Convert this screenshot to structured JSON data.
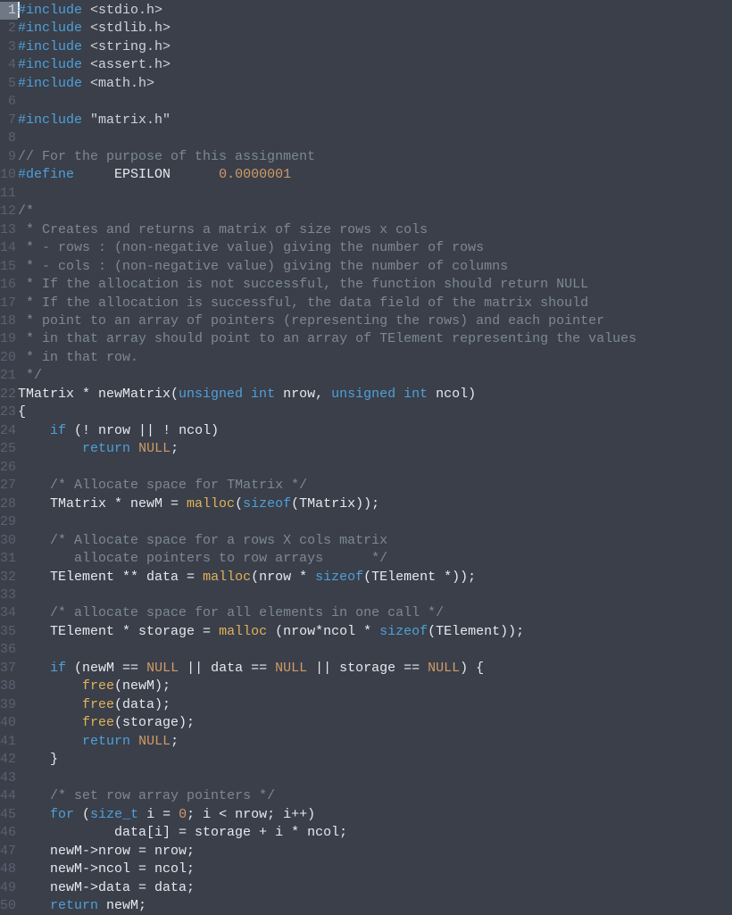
{
  "editor": {
    "active_line": 1,
    "total_lines": 50
  },
  "code": {
    "lines": [
      {
        "n": 1,
        "tokens": [
          [
            "kw",
            "#include "
          ],
          [
            "incbr",
            "<stdio.h>"
          ]
        ]
      },
      {
        "n": 2,
        "tokens": [
          [
            "kw",
            "#include "
          ],
          [
            "incbr",
            "<stdlib.h>"
          ]
        ]
      },
      {
        "n": 3,
        "tokens": [
          [
            "kw",
            "#include "
          ],
          [
            "incbr",
            "<string.h>"
          ]
        ]
      },
      {
        "n": 4,
        "tokens": [
          [
            "kw",
            "#include "
          ],
          [
            "incbr",
            "<assert.h>"
          ]
        ]
      },
      {
        "n": 5,
        "tokens": [
          [
            "kw",
            "#include "
          ],
          [
            "incbr",
            "<math.h>"
          ]
        ]
      },
      {
        "n": 6,
        "tokens": []
      },
      {
        "n": 7,
        "tokens": [
          [
            "kw",
            "#include "
          ],
          [
            "str",
            "\"matrix.h\""
          ]
        ]
      },
      {
        "n": 8,
        "tokens": []
      },
      {
        "n": 9,
        "tokens": [
          [
            "cmt",
            "// For the purpose of this assignment"
          ]
        ]
      },
      {
        "n": 10,
        "tokens": [
          [
            "kw",
            "#define"
          ],
          [
            "plain",
            "     EPSILON      "
          ],
          [
            "num",
            "0.0000001"
          ]
        ]
      },
      {
        "n": 11,
        "tokens": []
      },
      {
        "n": 12,
        "tokens": [
          [
            "cmt",
            "/*"
          ]
        ]
      },
      {
        "n": 13,
        "tokens": [
          [
            "cmt",
            " * Creates and returns a matrix of size rows x cols"
          ]
        ]
      },
      {
        "n": 14,
        "tokens": [
          [
            "cmt",
            " * - rows : (non-negative value) giving the number of rows"
          ]
        ]
      },
      {
        "n": 15,
        "tokens": [
          [
            "cmt",
            " * - cols : (non-negative value) giving the number of columns"
          ]
        ]
      },
      {
        "n": 16,
        "tokens": [
          [
            "cmt",
            " * If the allocation is not successful, the function should return NULL"
          ]
        ]
      },
      {
        "n": 17,
        "tokens": [
          [
            "cmt",
            " * If the allocation is successful, the data field of the matrix should"
          ]
        ]
      },
      {
        "n": 18,
        "tokens": [
          [
            "cmt",
            " * point to an array of pointers (representing the rows) and each pointer"
          ]
        ]
      },
      {
        "n": 19,
        "tokens": [
          [
            "cmt",
            " * in that array should point to an array of TElement representing the values"
          ]
        ]
      },
      {
        "n": 20,
        "tokens": [
          [
            "cmt",
            " * in that row."
          ]
        ]
      },
      {
        "n": 21,
        "tokens": [
          [
            "cmt",
            " */"
          ]
        ]
      },
      {
        "n": 22,
        "tokens": [
          [
            "plain",
            "TMatrix * newMatrix("
          ],
          [
            "type",
            "unsigned int"
          ],
          [
            "plain",
            " nrow, "
          ],
          [
            "type",
            "unsigned int"
          ],
          [
            "plain",
            " ncol)"
          ]
        ]
      },
      {
        "n": 23,
        "tokens": [
          [
            "plain",
            "{"
          ]
        ]
      },
      {
        "n": 24,
        "tokens": [
          [
            "plain",
            "    "
          ],
          [
            "kw",
            "if"
          ],
          [
            "plain",
            " (! nrow || ! ncol)"
          ]
        ]
      },
      {
        "n": 25,
        "tokens": [
          [
            "plain",
            "        "
          ],
          [
            "kw",
            "return"
          ],
          [
            "plain",
            " "
          ],
          [
            "null",
            "NULL"
          ],
          [
            "plain",
            ";"
          ]
        ]
      },
      {
        "n": 26,
        "tokens": []
      },
      {
        "n": 27,
        "tokens": [
          [
            "plain",
            "    "
          ],
          [
            "cmt",
            "/* Allocate space for TMatrix */"
          ]
        ]
      },
      {
        "n": 28,
        "tokens": [
          [
            "plain",
            "    TMatrix * newM = "
          ],
          [
            "fn",
            "malloc"
          ],
          [
            "plain",
            "("
          ],
          [
            "kw",
            "sizeof"
          ],
          [
            "plain",
            "(TMatrix));"
          ]
        ]
      },
      {
        "n": 29,
        "tokens": []
      },
      {
        "n": 30,
        "tokens": [
          [
            "plain",
            "    "
          ],
          [
            "cmt",
            "/* Allocate space for a rows X cols matrix"
          ]
        ]
      },
      {
        "n": 31,
        "tokens": [
          [
            "plain",
            "    "
          ],
          [
            "cmt",
            "   allocate pointers to row arrays      */"
          ]
        ]
      },
      {
        "n": 32,
        "tokens": [
          [
            "plain",
            "    TElement ** data = "
          ],
          [
            "fn",
            "malloc"
          ],
          [
            "plain",
            "(nrow * "
          ],
          [
            "kw",
            "sizeof"
          ],
          [
            "plain",
            "(TElement *));"
          ]
        ]
      },
      {
        "n": 33,
        "tokens": []
      },
      {
        "n": 34,
        "tokens": [
          [
            "plain",
            "    "
          ],
          [
            "cmt",
            "/* allocate space for all elements in one call */"
          ]
        ]
      },
      {
        "n": 35,
        "tokens": [
          [
            "plain",
            "    TElement * storage = "
          ],
          [
            "fn",
            "malloc"
          ],
          [
            "plain",
            " (nrow*ncol * "
          ],
          [
            "kw",
            "sizeof"
          ],
          [
            "plain",
            "(TElement));"
          ]
        ]
      },
      {
        "n": 36,
        "tokens": []
      },
      {
        "n": 37,
        "tokens": [
          [
            "plain",
            "    "
          ],
          [
            "kw",
            "if"
          ],
          [
            "plain",
            " (newM == "
          ],
          [
            "null",
            "NULL"
          ],
          [
            "plain",
            " || data == "
          ],
          [
            "null",
            "NULL"
          ],
          [
            "plain",
            " || storage == "
          ],
          [
            "null",
            "NULL"
          ],
          [
            "plain",
            ") {"
          ]
        ]
      },
      {
        "n": 38,
        "tokens": [
          [
            "plain",
            "        "
          ],
          [
            "fn",
            "free"
          ],
          [
            "plain",
            "(newM);"
          ]
        ]
      },
      {
        "n": 39,
        "tokens": [
          [
            "plain",
            "        "
          ],
          [
            "fn",
            "free"
          ],
          [
            "plain",
            "(data);"
          ]
        ]
      },
      {
        "n": 40,
        "tokens": [
          [
            "plain",
            "        "
          ],
          [
            "fn",
            "free"
          ],
          [
            "plain",
            "(storage);"
          ]
        ]
      },
      {
        "n": 41,
        "tokens": [
          [
            "plain",
            "        "
          ],
          [
            "kw",
            "return"
          ],
          [
            "plain",
            " "
          ],
          [
            "null",
            "NULL"
          ],
          [
            "plain",
            ";"
          ]
        ]
      },
      {
        "n": 42,
        "tokens": [
          [
            "plain",
            "    }"
          ]
        ]
      },
      {
        "n": 43,
        "tokens": []
      },
      {
        "n": 44,
        "tokens": [
          [
            "plain",
            "    "
          ],
          [
            "cmt",
            "/* set row array pointers */"
          ]
        ]
      },
      {
        "n": 45,
        "tokens": [
          [
            "plain",
            "    "
          ],
          [
            "kw",
            "for"
          ],
          [
            "plain",
            " ("
          ],
          [
            "type",
            "size_t"
          ],
          [
            "plain",
            " i = "
          ],
          [
            "num",
            "0"
          ],
          [
            "plain",
            "; i < nrow; i++)"
          ]
        ]
      },
      {
        "n": 46,
        "tokens": [
          [
            "plain",
            "            data[i] = storage + i * ncol;"
          ]
        ]
      },
      {
        "n": 47,
        "tokens": [
          [
            "plain",
            "    newM->nrow = nrow;"
          ]
        ]
      },
      {
        "n": 48,
        "tokens": [
          [
            "plain",
            "    newM->ncol = ncol;"
          ]
        ]
      },
      {
        "n": 49,
        "tokens": [
          [
            "plain",
            "    newM->data = data;"
          ]
        ]
      },
      {
        "n": 50,
        "tokens": [
          [
            "plain",
            "    "
          ],
          [
            "kw",
            "return"
          ],
          [
            "plain",
            " newM;"
          ]
        ]
      }
    ]
  }
}
